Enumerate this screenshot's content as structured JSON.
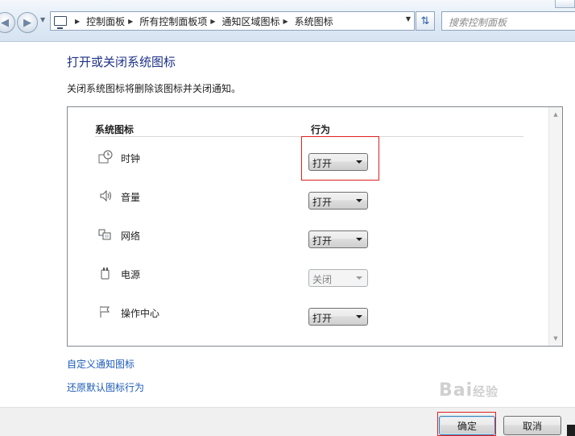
{
  "address_bar": {
    "breadcrumbs": [
      "控制面板",
      "所有控制面板项",
      "通知区域图标",
      "系统图标"
    ],
    "search_placeholder": "搜索控制面板"
  },
  "page": {
    "title": "打开或关闭系统图标",
    "description": "关闭系统图标将删除该图标并关闭通知。"
  },
  "table": {
    "col_icon": "系统图标",
    "col_behavior": "行为",
    "rows": [
      {
        "label": "时钟",
        "icon": "clock-icon",
        "value": "打开",
        "enabled": true
      },
      {
        "label": "音量",
        "icon": "volume-icon",
        "value": "打开",
        "enabled": true
      },
      {
        "label": "网络",
        "icon": "network-icon",
        "value": "打开",
        "enabled": true
      },
      {
        "label": "电源",
        "icon": "power-icon",
        "value": "关闭",
        "enabled": false
      },
      {
        "label": "操作中心",
        "icon": "flag-icon",
        "value": "打开",
        "enabled": true
      }
    ]
  },
  "links": {
    "customize": "自定义通知图标",
    "restore": "还原默认图标行为"
  },
  "buttons": {
    "ok": "确定",
    "cancel": "取消"
  },
  "watermark": {
    "brand": "Bai",
    "suffix": "经验"
  },
  "colors": {
    "title": "#1e3287",
    "link": "#1c5bb9",
    "highlight": "#e02020"
  }
}
